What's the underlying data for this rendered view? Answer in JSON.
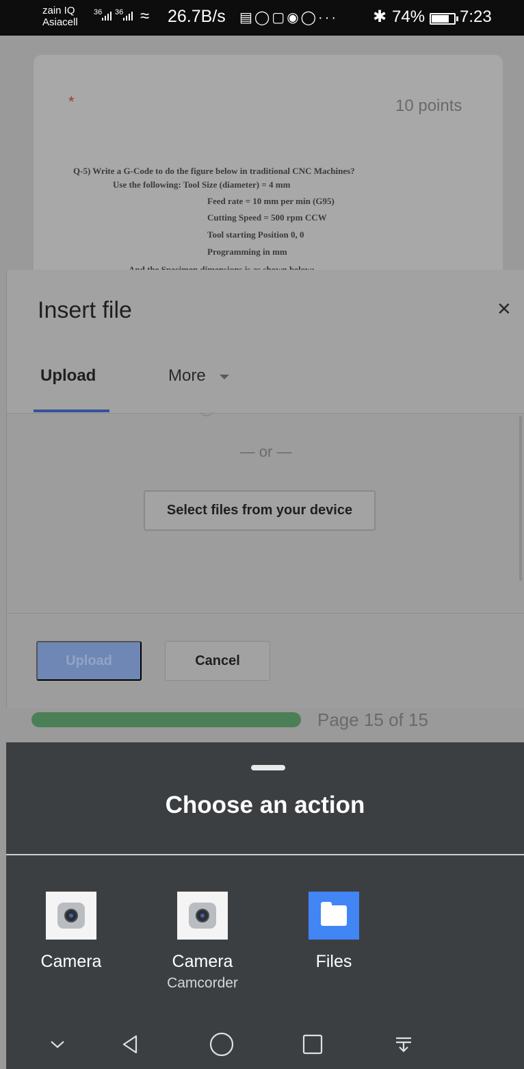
{
  "status": {
    "carrier1": "zain IQ",
    "carrier2": "Asiacell",
    "sim1": "36",
    "sim2": "36",
    "net_speed": "26.7B/s",
    "battery_pct": "74%",
    "battery_level": 0.74,
    "time": "7:23",
    "more": "···"
  },
  "form": {
    "required_mark": "*",
    "points": "10 points",
    "question_lines": [
      "Q-5) Write a G-Code to do the figure below in traditional CNC Machines?",
      "Use the following:     Tool Size (diameter) = 4 mm",
      "Feed rate = 10 mm per min (G95)",
      "Cutting Speed = 500 rpm CCW",
      "Tool starting Position 0, 0",
      "Programming in mm",
      "And the Specimen dimensions is as shown below:"
    ]
  },
  "dialog": {
    "title": "Insert file",
    "tabs": [
      {
        "label": "Upload",
        "active": true
      },
      {
        "label": "More",
        "active": false
      }
    ],
    "or_text": "— or —",
    "select_button": "Select files from your device",
    "upload_button": "Upload",
    "cancel_button": "Cancel"
  },
  "progress": {
    "page_label": "Page 15 of 15",
    "fraction": 1.0
  },
  "sheet": {
    "title": "Choose an action",
    "apps": [
      {
        "label": "Camera",
        "sub": "",
        "icon": "camera-icon"
      },
      {
        "label": "Camera",
        "sub": "Camcorder",
        "icon": "camcorder-icon"
      },
      {
        "label": "Files",
        "sub": "",
        "icon": "files-icon"
      }
    ]
  },
  "colors": {
    "accent": "#33529a",
    "progress": "#4b7f56",
    "sheet_bg": "#3c3f42",
    "files": "#4285f4"
  }
}
